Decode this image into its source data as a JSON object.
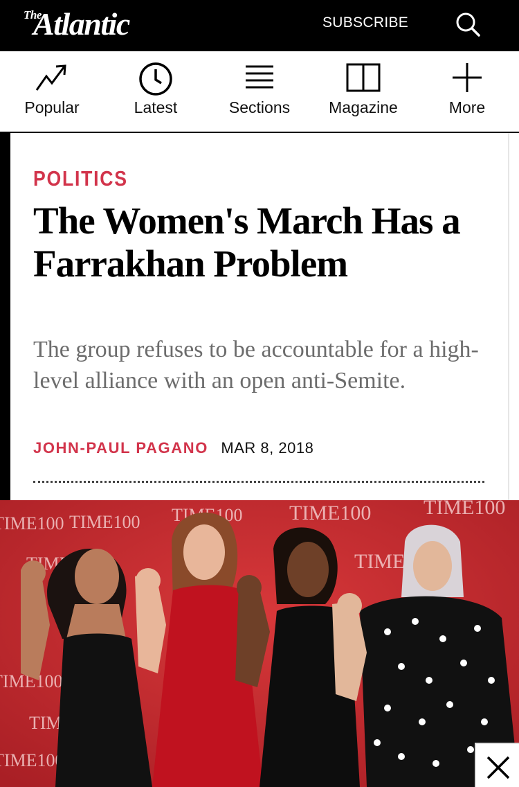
{
  "header": {
    "logo_the": "The",
    "logo_main": "Atlantic",
    "subscribe_label": "SUBSCRIBE",
    "search_icon": "search-icon"
  },
  "nav": {
    "items": [
      {
        "label": "Popular",
        "icon": "trending-icon"
      },
      {
        "label": "Latest",
        "icon": "clock-icon"
      },
      {
        "label": "Sections",
        "icon": "menu-icon"
      },
      {
        "label": "Magazine",
        "icon": "book-icon"
      },
      {
        "label": "More",
        "icon": "plus-icon"
      }
    ]
  },
  "article": {
    "section": "POLITICS",
    "headline": "The Women's March Has a Farrakhan Problem",
    "dek": "The group refuses to be accountable for a high-level alliance with an open anti-Semite.",
    "author": "JOHN-PAUL PAGANO",
    "date": "MAR 8, 2018"
  },
  "hero": {
    "backdrop_text": "TIME100",
    "close_icon": "close-icon"
  },
  "colors": {
    "accent": "#d2344b",
    "header_bg": "#000000",
    "dek_gray": "#6c6c6c",
    "backdrop_red": "#c32b2e"
  }
}
